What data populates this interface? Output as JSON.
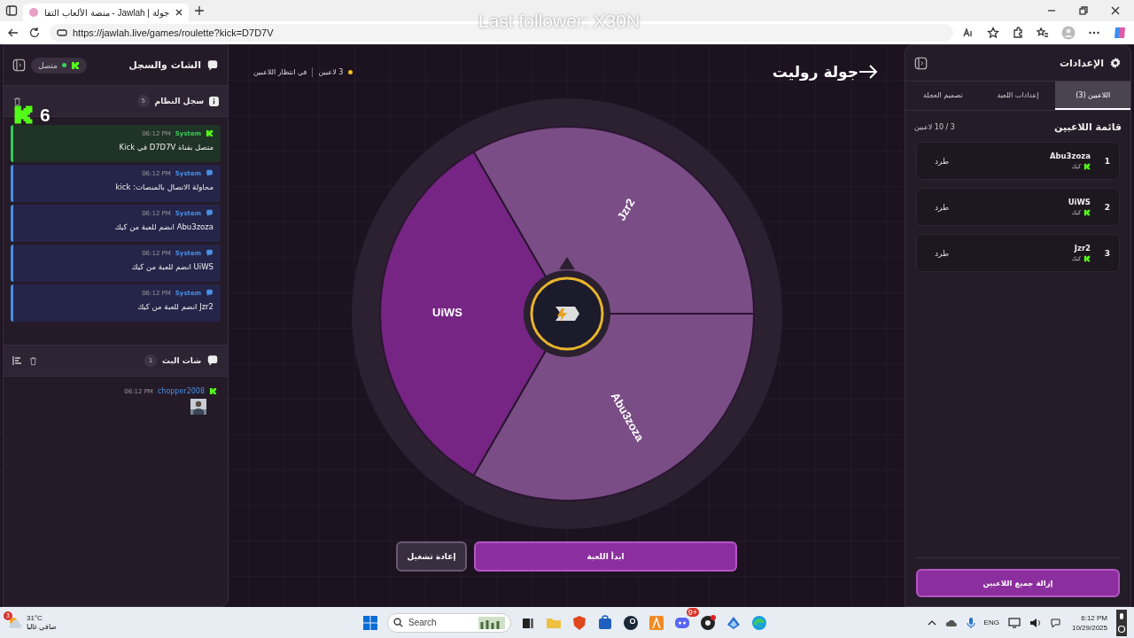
{
  "browser": {
    "tab_title": "جولة | Jawlah - منصة الألعاب التفا",
    "url": "https://jawlah.live/games/roulette?kick=D7D7V"
  },
  "overlay": {
    "follower": "Last follower: X30N",
    "counter": "6"
  },
  "chat_panel": {
    "title": "الشات والسجل",
    "status": "متصل",
    "connected": true,
    "system_log": {
      "title": "سجل النظام",
      "count": "5",
      "entries": [
        {
          "kind": "kick",
          "sender": "System",
          "time": "06:12 PM",
          "text": "متصل بقناة D7D7V في Kick"
        },
        {
          "kind": "system",
          "sender": "System",
          "time": "06:12 PM",
          "text": "محاولة الاتصال بالمنصات: kick"
        },
        {
          "kind": "system",
          "sender": "System",
          "time": "06:12 PM",
          "text": "Abu3zoza انضم للعبة من كيك"
        },
        {
          "kind": "system",
          "sender": "System",
          "time": "06:12 PM",
          "text": "UiWS انضم للعبة من كيك"
        },
        {
          "kind": "system",
          "sender": "System",
          "time": "06:12 PM",
          "text": "Jzr2 انضم للعبة من كيك"
        }
      ]
    },
    "stream_chat": {
      "title": "شات البث",
      "count": "1",
      "messages": [
        {
          "kind": "kick",
          "user": "chopper2008",
          "time": "06:12 PM"
        }
      ]
    }
  },
  "game": {
    "title": "جولة روليت",
    "players_count": "3 لاعبين",
    "status": "في انتظار اللاعبين",
    "wheel": {
      "segments": [
        {
          "label": "Jzr2",
          "color": "#7a4d86"
        },
        {
          "label": "Abu3zoza",
          "color": "#7a4d86"
        },
        {
          "label": "UiWS",
          "color": "#762584"
        }
      ]
    },
    "start_button": "ابدأ اللعبة",
    "restart_button": "إعادة تشغيل"
  },
  "settings_panel": {
    "title": "الإعدادات",
    "tabs": [
      {
        "label": "اللاعبين (3)",
        "selected": true
      },
      {
        "label": "إعدادات اللعبة",
        "selected": false
      },
      {
        "label": "تصميم العجلة",
        "selected": false
      }
    ],
    "list_title": "قائمة اللاعبين",
    "capacity": "3 / 10 لاعبين",
    "players": [
      {
        "rank": "1",
        "name": "Abu3zoza",
        "platform": "كيك",
        "action": "طرد"
      },
      {
        "rank": "2",
        "name": "UiWS",
        "platform": "كيك",
        "action": "طرد"
      },
      {
        "rank": "3",
        "name": "Jzr2",
        "platform": "كيك",
        "action": "طرد"
      }
    ],
    "remove_all_button": "إزالة جميع اللاعبين"
  },
  "taskbar": {
    "weather": {
      "badge": "3",
      "temperature": "31°C",
      "condition": "صافي غالبا"
    },
    "search_placeholder": "Search",
    "discord_badge": "9+",
    "language": "ENG",
    "time": "6:12 PM",
    "date": "10/29/2025"
  }
}
